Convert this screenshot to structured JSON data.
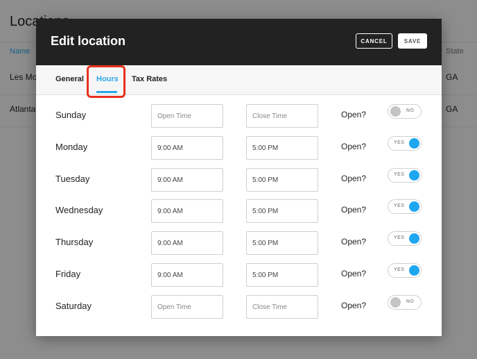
{
  "background": {
    "title": "Locations",
    "columns": {
      "name": "Name",
      "state": "State"
    },
    "rows": [
      {
        "name": "Les Moines",
        "state": "GA"
      },
      {
        "name": "Atlanta",
        "state": "GA"
      }
    ]
  },
  "modal": {
    "title": "Edit location",
    "cancel_label": "CANCEL",
    "save_label": "SAVE",
    "tabs": [
      {
        "label": "General"
      },
      {
        "label": "Hours"
      },
      {
        "label": "Tax Rates"
      }
    ],
    "active_tab": "Hours",
    "open_label": "Open?",
    "days": [
      {
        "name": "Sunday",
        "open_time": "",
        "close_time": "",
        "open": false,
        "toggle_label": "NO"
      },
      {
        "name": "Monday",
        "open_time": "9:00 AM",
        "close_time": "5:00 PM",
        "open": true,
        "toggle_label": "YES"
      },
      {
        "name": "Tuesday",
        "open_time": "9:00 AM",
        "close_time": "5:00 PM",
        "open": true,
        "toggle_label": "YES"
      },
      {
        "name": "Wednesday",
        "open_time": "9:00 AM",
        "close_time": "5:00 PM",
        "open": true,
        "toggle_label": "YES"
      },
      {
        "name": "Thursday",
        "open_time": "9:00 AM",
        "close_time": "5:00 PM",
        "open": true,
        "toggle_label": "YES"
      },
      {
        "name": "Friday",
        "open_time": "9:00 AM",
        "close_time": "5:00 PM",
        "open": true,
        "toggle_label": "YES"
      },
      {
        "name": "Saturday",
        "open_time": "",
        "close_time": "",
        "open": false,
        "toggle_label": "NO"
      }
    ],
    "placeholders": {
      "open_time": "Open Time",
      "close_time": "Close Time"
    }
  },
  "colors": {
    "accent": "#1ea7f0",
    "header_bg": "#222222",
    "highlight": "#e8301c"
  }
}
